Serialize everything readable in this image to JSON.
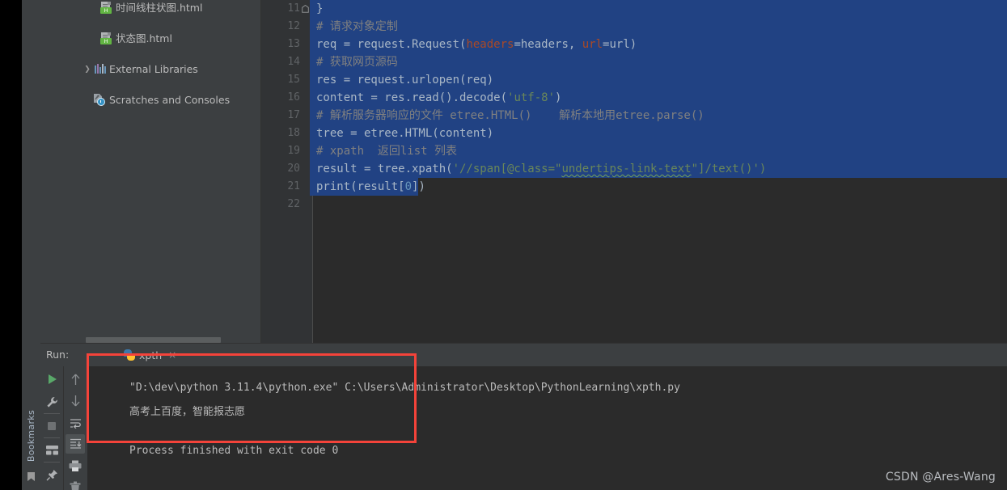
{
  "window": {
    "background": "#2b2b2b",
    "accent": "#4a88c7",
    "annotation_color": "#f4433a"
  },
  "left_strip": {
    "bookmarks_label": "Bookmarks",
    "bookmark_icon": "bookmark-flag-icon"
  },
  "project_tree": {
    "items": [
      {
        "label": "时间线柱状图.html",
        "icon": "html-file-icon",
        "indent": 82,
        "arrow": "",
        "expandable": false
      },
      {
        "label": "状态图.html",
        "icon": "html-file-icon",
        "indent": 82,
        "arrow": "",
        "expandable": false
      },
      {
        "label": "External Libraries",
        "icon": "libraries-icon",
        "indent": 74,
        "arrow": "›",
        "expandable": true
      },
      {
        "label": "Scratches and Consoles",
        "icon": "scratches-icon",
        "indent": 74,
        "arrow": "",
        "expandable": false
      }
    ],
    "horizontal_scrollbar": "project-hscrollbar"
  },
  "editor": {
    "first_line_number": 11,
    "lines": [
      {
        "num": 11,
        "selected": true,
        "fold": true,
        "tokens": [
          {
            "t": "}",
            "c": "def"
          }
        ]
      },
      {
        "num": 12,
        "selected": true,
        "tokens": [
          {
            "t": "# 请求对象定制",
            "c": "cmt"
          }
        ]
      },
      {
        "num": 13,
        "selected": true,
        "tokens": [
          {
            "t": "req = request.Request(",
            "c": "def"
          },
          {
            "t": "headers",
            "c": "named"
          },
          {
            "t": "=headers, ",
            "c": "def"
          },
          {
            "t": "url",
            "c": "named"
          },
          {
            "t": "=url)",
            "c": "def"
          }
        ]
      },
      {
        "num": 14,
        "selected": true,
        "tokens": [
          {
            "t": "# 获取网页源码",
            "c": "cmt"
          }
        ]
      },
      {
        "num": 15,
        "selected": true,
        "tokens": [
          {
            "t": "res = request.urlopen(req)",
            "c": "def"
          }
        ]
      },
      {
        "num": 16,
        "selected": true,
        "tokens": [
          {
            "t": "content = res.read().decode(",
            "c": "def"
          },
          {
            "t": "'utf-8'",
            "c": "str"
          },
          {
            "t": ")",
            "c": "def"
          }
        ]
      },
      {
        "num": 17,
        "selected": true,
        "tokens": [
          {
            "t": "# 解析服务器响应的文件 etree.HTML()    解析本地用etree.parse()",
            "c": "cmt"
          }
        ]
      },
      {
        "num": 18,
        "selected": true,
        "tokens": [
          {
            "t": "tree = etree.HTML(content)",
            "c": "def"
          }
        ]
      },
      {
        "num": 19,
        "selected": true,
        "tokens": [
          {
            "t": "# xpath  返回list 列表",
            "c": "cmt"
          }
        ]
      },
      {
        "num": 20,
        "selected": true,
        "tokens": [
          {
            "t": "result = tree.xpath(",
            "c": "def"
          },
          {
            "t": "'//span[@class=\"",
            "c": "str"
          },
          {
            "t": "undertips-link-text",
            "c": "str-squiggle"
          },
          {
            "t": "\"]/text()')",
            "c": "str"
          }
        ]
      },
      {
        "num": 21,
        "selected": true,
        "selection_width": 130,
        "tokens": [
          {
            "t": "print(",
            "c": "def"
          },
          {
            "t": "result[",
            "c": "def"
          },
          {
            "t": "0",
            "c": "num"
          },
          {
            "t": "])",
            "c": "def"
          }
        ]
      },
      {
        "num": 22,
        "selected": false,
        "tokens": []
      }
    ]
  },
  "run_panel": {
    "title": "Run:",
    "tab": {
      "name": "xpth",
      "icon": "python-file-icon",
      "close": "×"
    },
    "toolbar_left": [
      {
        "name": "run-button",
        "icon": "play-icon"
      },
      {
        "name": "settings-button",
        "icon": "wrench-icon"
      },
      {
        "name": "stop-button",
        "icon": "stop-square-icon"
      },
      {
        "name": "layout-button",
        "icon": "layout-icon"
      },
      {
        "name": "pin-button",
        "icon": "pin-icon"
      }
    ],
    "toolbar_right": [
      {
        "name": "scroll-up-button",
        "icon": "arrow-up-icon"
      },
      {
        "name": "scroll-down-button",
        "icon": "arrow-down-icon"
      },
      {
        "name": "soft-wrap-button",
        "icon": "soft-wrap-icon"
      },
      {
        "name": "scroll-to-end-button",
        "icon": "scroll-to-end-icon",
        "active": true
      },
      {
        "name": "print-button",
        "icon": "printer-icon"
      },
      {
        "name": "clear-all-button",
        "icon": "trash-icon"
      }
    ],
    "console": {
      "command_line": "\"D:\\dev\\python 3.11.4\\python.exe\" C:\\Users\\Administrator\\Desktop\\PythonLearning\\xpth.py",
      "output_line": "高考上百度，智能报志愿",
      "exit_line": "Process finished with exit code 0"
    }
  },
  "annotation": {
    "type": "red-rectangle-highlight"
  },
  "watermark": {
    "text": "CSDN @Ares-Wang"
  }
}
